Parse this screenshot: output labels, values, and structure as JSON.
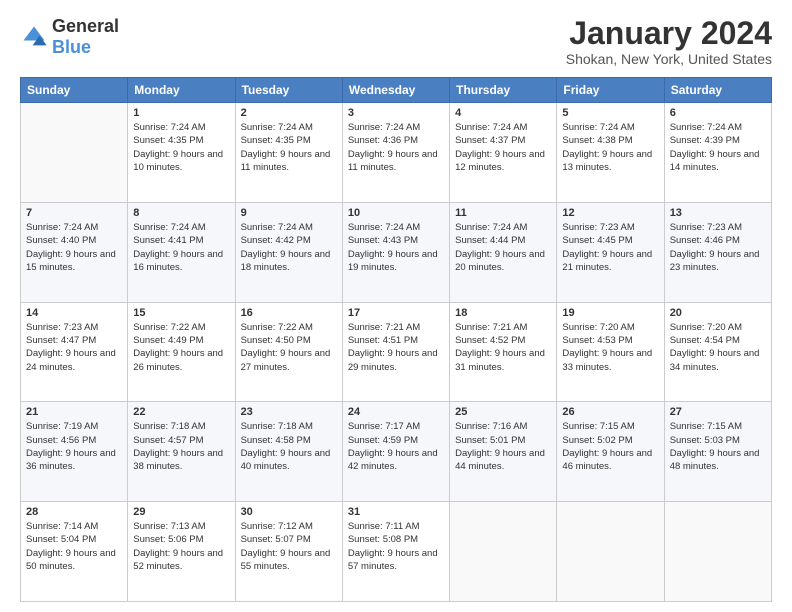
{
  "header": {
    "logo": {
      "general": "General",
      "blue": "Blue"
    },
    "title": "January 2024",
    "location": "Shokan, New York, United States"
  },
  "weekdays": [
    "Sunday",
    "Monday",
    "Tuesday",
    "Wednesday",
    "Thursday",
    "Friday",
    "Saturday"
  ],
  "weeks": [
    [
      {
        "day": "",
        "sunrise": "",
        "sunset": "",
        "daylight": ""
      },
      {
        "day": "1",
        "sunrise": "Sunrise: 7:24 AM",
        "sunset": "Sunset: 4:35 PM",
        "daylight": "Daylight: 9 hours and 10 minutes."
      },
      {
        "day": "2",
        "sunrise": "Sunrise: 7:24 AM",
        "sunset": "Sunset: 4:35 PM",
        "daylight": "Daylight: 9 hours and 11 minutes."
      },
      {
        "day": "3",
        "sunrise": "Sunrise: 7:24 AM",
        "sunset": "Sunset: 4:36 PM",
        "daylight": "Daylight: 9 hours and 11 minutes."
      },
      {
        "day": "4",
        "sunrise": "Sunrise: 7:24 AM",
        "sunset": "Sunset: 4:37 PM",
        "daylight": "Daylight: 9 hours and 12 minutes."
      },
      {
        "day": "5",
        "sunrise": "Sunrise: 7:24 AM",
        "sunset": "Sunset: 4:38 PM",
        "daylight": "Daylight: 9 hours and 13 minutes."
      },
      {
        "day": "6",
        "sunrise": "Sunrise: 7:24 AM",
        "sunset": "Sunset: 4:39 PM",
        "daylight": "Daylight: 9 hours and 14 minutes."
      }
    ],
    [
      {
        "day": "7",
        "sunrise": "Sunrise: 7:24 AM",
        "sunset": "Sunset: 4:40 PM",
        "daylight": "Daylight: 9 hours and 15 minutes."
      },
      {
        "day": "8",
        "sunrise": "Sunrise: 7:24 AM",
        "sunset": "Sunset: 4:41 PM",
        "daylight": "Daylight: 9 hours and 16 minutes."
      },
      {
        "day": "9",
        "sunrise": "Sunrise: 7:24 AM",
        "sunset": "Sunset: 4:42 PM",
        "daylight": "Daylight: 9 hours and 18 minutes."
      },
      {
        "day": "10",
        "sunrise": "Sunrise: 7:24 AM",
        "sunset": "Sunset: 4:43 PM",
        "daylight": "Daylight: 9 hours and 19 minutes."
      },
      {
        "day": "11",
        "sunrise": "Sunrise: 7:24 AM",
        "sunset": "Sunset: 4:44 PM",
        "daylight": "Daylight: 9 hours and 20 minutes."
      },
      {
        "day": "12",
        "sunrise": "Sunrise: 7:23 AM",
        "sunset": "Sunset: 4:45 PM",
        "daylight": "Daylight: 9 hours and 21 minutes."
      },
      {
        "day": "13",
        "sunrise": "Sunrise: 7:23 AM",
        "sunset": "Sunset: 4:46 PM",
        "daylight": "Daylight: 9 hours and 23 minutes."
      }
    ],
    [
      {
        "day": "14",
        "sunrise": "Sunrise: 7:23 AM",
        "sunset": "Sunset: 4:47 PM",
        "daylight": "Daylight: 9 hours and 24 minutes."
      },
      {
        "day": "15",
        "sunrise": "Sunrise: 7:22 AM",
        "sunset": "Sunset: 4:49 PM",
        "daylight": "Daylight: 9 hours and 26 minutes."
      },
      {
        "day": "16",
        "sunrise": "Sunrise: 7:22 AM",
        "sunset": "Sunset: 4:50 PM",
        "daylight": "Daylight: 9 hours and 27 minutes."
      },
      {
        "day": "17",
        "sunrise": "Sunrise: 7:21 AM",
        "sunset": "Sunset: 4:51 PM",
        "daylight": "Daylight: 9 hours and 29 minutes."
      },
      {
        "day": "18",
        "sunrise": "Sunrise: 7:21 AM",
        "sunset": "Sunset: 4:52 PM",
        "daylight": "Daylight: 9 hours and 31 minutes."
      },
      {
        "day": "19",
        "sunrise": "Sunrise: 7:20 AM",
        "sunset": "Sunset: 4:53 PM",
        "daylight": "Daylight: 9 hours and 33 minutes."
      },
      {
        "day": "20",
        "sunrise": "Sunrise: 7:20 AM",
        "sunset": "Sunset: 4:54 PM",
        "daylight": "Daylight: 9 hours and 34 minutes."
      }
    ],
    [
      {
        "day": "21",
        "sunrise": "Sunrise: 7:19 AM",
        "sunset": "Sunset: 4:56 PM",
        "daylight": "Daylight: 9 hours and 36 minutes."
      },
      {
        "day": "22",
        "sunrise": "Sunrise: 7:18 AM",
        "sunset": "Sunset: 4:57 PM",
        "daylight": "Daylight: 9 hours and 38 minutes."
      },
      {
        "day": "23",
        "sunrise": "Sunrise: 7:18 AM",
        "sunset": "Sunset: 4:58 PM",
        "daylight": "Daylight: 9 hours and 40 minutes."
      },
      {
        "day": "24",
        "sunrise": "Sunrise: 7:17 AM",
        "sunset": "Sunset: 4:59 PM",
        "daylight": "Daylight: 9 hours and 42 minutes."
      },
      {
        "day": "25",
        "sunrise": "Sunrise: 7:16 AM",
        "sunset": "Sunset: 5:01 PM",
        "daylight": "Daylight: 9 hours and 44 minutes."
      },
      {
        "day": "26",
        "sunrise": "Sunrise: 7:15 AM",
        "sunset": "Sunset: 5:02 PM",
        "daylight": "Daylight: 9 hours and 46 minutes."
      },
      {
        "day": "27",
        "sunrise": "Sunrise: 7:15 AM",
        "sunset": "Sunset: 5:03 PM",
        "daylight": "Daylight: 9 hours and 48 minutes."
      }
    ],
    [
      {
        "day": "28",
        "sunrise": "Sunrise: 7:14 AM",
        "sunset": "Sunset: 5:04 PM",
        "daylight": "Daylight: 9 hours and 50 minutes."
      },
      {
        "day": "29",
        "sunrise": "Sunrise: 7:13 AM",
        "sunset": "Sunset: 5:06 PM",
        "daylight": "Daylight: 9 hours and 52 minutes."
      },
      {
        "day": "30",
        "sunrise": "Sunrise: 7:12 AM",
        "sunset": "Sunset: 5:07 PM",
        "daylight": "Daylight: 9 hours and 55 minutes."
      },
      {
        "day": "31",
        "sunrise": "Sunrise: 7:11 AM",
        "sunset": "Sunset: 5:08 PM",
        "daylight": "Daylight: 9 hours and 57 minutes."
      },
      {
        "day": "",
        "sunrise": "",
        "sunset": "",
        "daylight": ""
      },
      {
        "day": "",
        "sunrise": "",
        "sunset": "",
        "daylight": ""
      },
      {
        "day": "",
        "sunrise": "",
        "sunset": "",
        "daylight": ""
      }
    ]
  ]
}
